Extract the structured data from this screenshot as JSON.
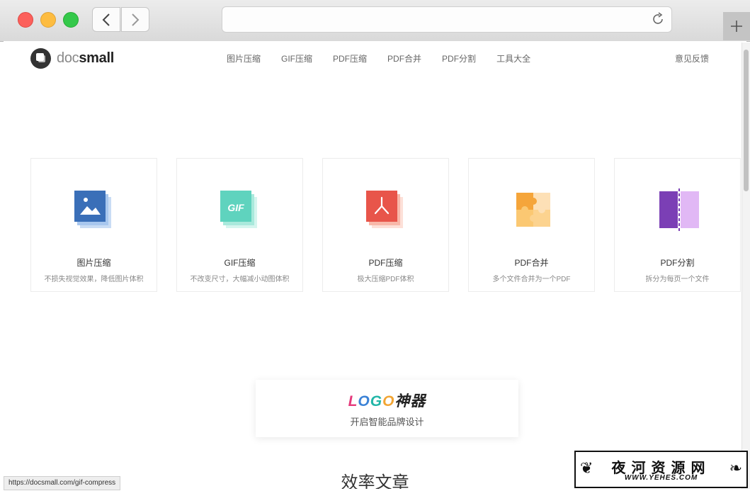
{
  "browser": {
    "address_value": "",
    "back_icon": "chevron-left-icon",
    "forward_icon": "chevron-right-icon",
    "reload_icon": "reload-icon",
    "new_tab_label": "+"
  },
  "header": {
    "logo_part1": "doc",
    "logo_part2": "small",
    "nav": [
      "图片压缩",
      "GIF压缩",
      "PDF压缩",
      "PDF合并",
      "PDF分割",
      "工具大全"
    ],
    "feedback": "意见反馈"
  },
  "tools": [
    {
      "title": "图片压缩",
      "desc": "不损失视觉效果，降低图片体积",
      "icon": "image-icon",
      "color": "#3a6fb8"
    },
    {
      "title": "GIF压缩",
      "desc": "不改变尺寸，大幅减小动图体积",
      "icon": "gif-icon",
      "color": "#5fd3be",
      "icon_text": "GIF"
    },
    {
      "title": "PDF压缩",
      "desc": "极大压缩PDF体积",
      "icon": "pdf-icon",
      "color": "#e8554a"
    },
    {
      "title": "PDF合并",
      "desc": "多个文件合并为一个PDF",
      "icon": "puzzle-icon",
      "color": "#f5a53a"
    },
    {
      "title": "PDF分割",
      "desc": "拆分为每页一个文件",
      "icon": "split-icon",
      "color": "#7b3fb5"
    }
  ],
  "ad": {
    "logo_l1": "L",
    "logo_l2": "O",
    "logo_l3": "G",
    "logo_l4": "O",
    "logo_cn": "神器",
    "subtitle": "开启智能品牌设计"
  },
  "section_title": "效率文章",
  "status_url": "https://docsmall.com/gif-compress",
  "watermark": {
    "title": "夜河资源网",
    "url": "WWW.YEHES.COM"
  }
}
